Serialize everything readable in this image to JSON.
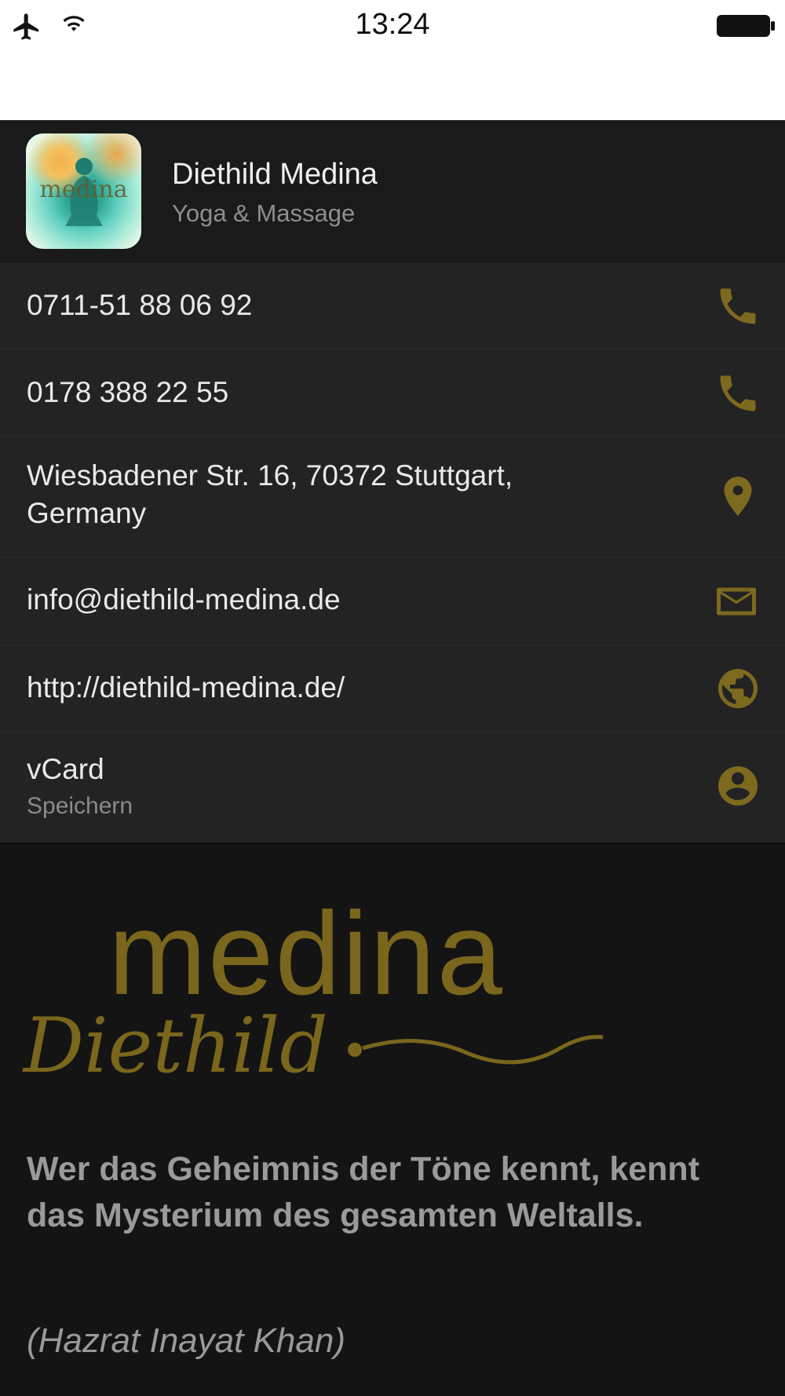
{
  "status_bar": {
    "time": "13:24"
  },
  "header": {
    "name": "Diethild Medina",
    "subtitle": "Yoga & Massage",
    "app_icon_text": "medina"
  },
  "contacts": [
    {
      "text": "0711-51 88 06 92",
      "icon": "phone-icon"
    },
    {
      "text": "0178 388 22 55",
      "icon": "phone-icon"
    },
    {
      "line1": "Wiesbadener Str. 16, 70372 Stuttgart,",
      "line2": "Germany",
      "icon": "location-pin-icon"
    },
    {
      "text": "info@diethild-medina.de",
      "icon": "mail-icon"
    },
    {
      "text": "http://diethild-medina.de/",
      "icon": "globe-icon"
    },
    {
      "text": "vCard",
      "sub": "Speichern",
      "icon": "contact-person-icon"
    }
  ],
  "logo": {
    "word": "medina",
    "script": "Diethild"
  },
  "quote": {
    "text": "Wer das Geheimnis der Töne kennt, kennt das Mysterium des gesamten Weltalls.",
    "author": "(Hazrat Inayat Khan)"
  },
  "colors": {
    "accent_gold": "#7d6a1f",
    "header_bg": "#1a1a1a",
    "list_bg": "#232323",
    "page_bg": "#141414"
  }
}
